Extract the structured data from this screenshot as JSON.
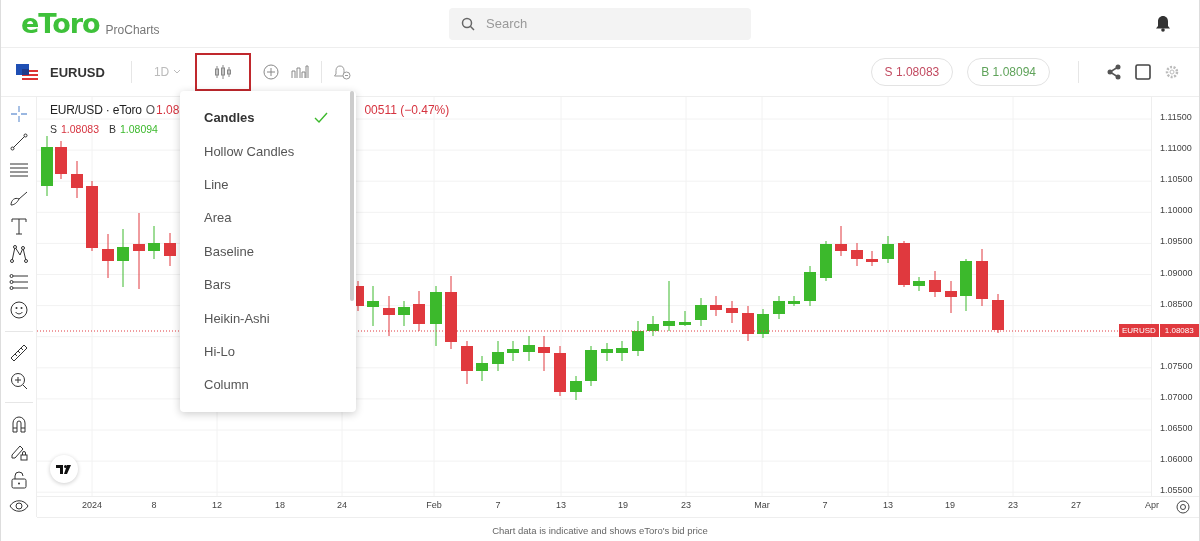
{
  "header": {
    "logo": "eToro",
    "product": "ProCharts",
    "search": {
      "placeholder": "Search"
    }
  },
  "toolbar": {
    "symbol": "EURUSD",
    "interval": "1D",
    "chart_type_open": true,
    "sell": "S 1.08083",
    "buy": "B 1.08094"
  },
  "legend": {
    "title": "EUR/USD · eToro",
    "open_label": "O",
    "open_value": "1.08",
    "change": "00511 (−0.47%)",
    "sell_label": "S",
    "sell_value": "1.08083",
    "buy_label": "B",
    "buy_value": "1.08094"
  },
  "chart_type_menu": {
    "items": [
      {
        "label": "Candles",
        "selected": true
      },
      {
        "label": "Hollow Candles",
        "selected": false
      },
      {
        "label": "Line",
        "selected": false
      },
      {
        "label": "Area",
        "selected": false
      },
      {
        "label": "Baseline",
        "selected": false
      },
      {
        "label": "Bars",
        "selected": false
      },
      {
        "label": "Heikin-Ashi",
        "selected": false
      },
      {
        "label": "Hi-Lo",
        "selected": false
      },
      {
        "label": "Column",
        "selected": false
      }
    ]
  },
  "chart": {
    "y_ticks": [
      "1.11500",
      "1.11000",
      "1.10500",
      "1.10000",
      "1.09500",
      "1.09000",
      "1.08500",
      "1.07500",
      "1.07000",
      "1.06500",
      "1.06000",
      "1.05500"
    ],
    "x_ticks": [
      "2024",
      "8",
      "12",
      "18",
      "24",
      "Feb",
      "7",
      "13",
      "19",
      "23",
      "Mar",
      "7",
      "13",
      "19",
      "23",
      "27",
      "Apr"
    ],
    "price_tag": {
      "symbol": "EURUSD",
      "price": "1.08083"
    }
  },
  "footer": "Chart data is indicative and shows eToro's bid price"
}
